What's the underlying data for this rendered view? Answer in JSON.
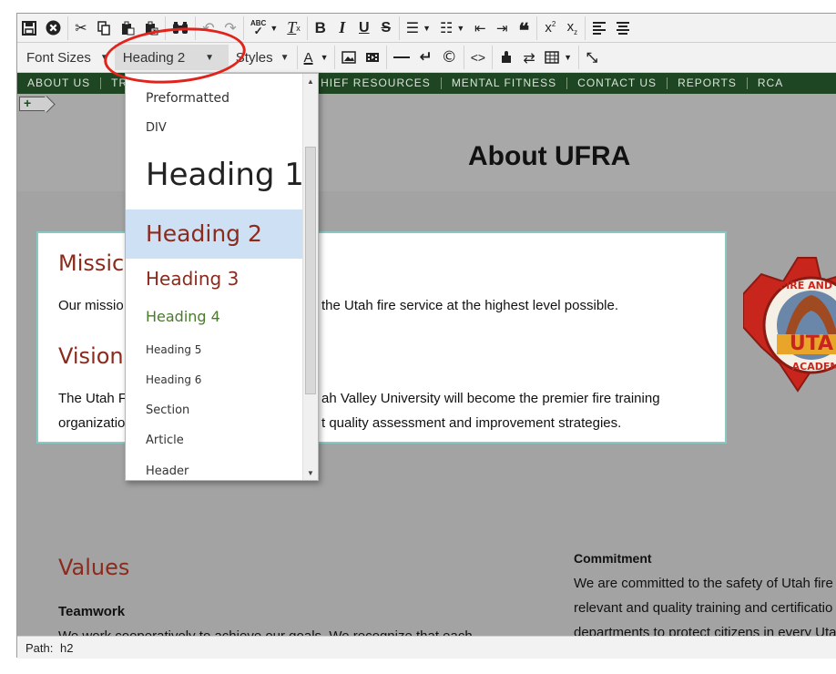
{
  "toolbar1": {
    "icons": [
      "save-icon",
      "cancel-icon",
      "cut-icon",
      "copy-icon",
      "paste-icon",
      "paste-text-icon",
      "find-icon",
      "undo-icon",
      "redo-icon",
      "spellcheck-icon",
      "clear-format-icon",
      "bold-icon",
      "italic-icon",
      "underline-icon",
      "strikethrough-icon",
      "bullet-list-icon",
      "numbered-list-icon",
      "outdent-icon",
      "indent-icon",
      "blockquote-icon",
      "superscript-icon",
      "subscript-icon",
      "align-left-icon",
      "align-center-icon"
    ]
  },
  "toolbar2": {
    "font_sizes_label": "Font Sizes",
    "block_format_value": "Heading 2",
    "styles_label": "Styles",
    "font_color_glyph": "A"
  },
  "nav": [
    "ABOUT US",
    "TR",
    "HIEF RESOURCES",
    "MENTAL FITNESS",
    "CONTACT US",
    "REPORTS",
    "RCA"
  ],
  "page": {
    "title": "About UFRA",
    "mission_heading": "Missic",
    "mission_text_left": "Our missio",
    "mission_text_right": "the Utah fire service at the highest level possible.",
    "vision_heading": "Vision",
    "vision_line1_left": "The Utah F",
    "vision_line1_right": "ah Valley University will become the premier fire training",
    "vision_line2_left": "organizatio",
    "vision_line2_right": "t quality assessment and improvement strategies.",
    "values_heading": "Values",
    "teamwork_heading": "Teamwork",
    "teamwork_text": "We work cooperatively to achieve our goals.  We recognize that each",
    "commitment_heading": "Commitment",
    "commitment_line1": "We are committed to the safety of Utah fire",
    "commitment_line2": "relevant and quality training and certificatio",
    "commitment_line3": "departments to protect citizens in every Uta"
  },
  "badge": {
    "text_top": "FIRE AND R",
    "text_mid": "UTA",
    "text_bottom": "ACADEM",
    "colors": {
      "red": "#c8261c",
      "gold": "#e8a52a",
      "brown": "#7a3b1e"
    }
  },
  "dropdown": {
    "items": [
      {
        "label": "Preformatted",
        "style": "pre"
      },
      {
        "label": "DIV",
        "style": "div"
      },
      {
        "label": "Heading 1",
        "style": "h1"
      },
      {
        "label": "Heading 2",
        "style": "h2",
        "selected": true
      },
      {
        "label": "Heading 3",
        "style": "h3"
      },
      {
        "label": "Heading 4",
        "style": "h4"
      },
      {
        "label": "Heading 5",
        "style": "h5"
      },
      {
        "label": "Heading 6",
        "style": "h6"
      },
      {
        "label": "Section",
        "style": "section"
      },
      {
        "label": "Article",
        "style": "article"
      },
      {
        "label": "Header",
        "style": "header"
      }
    ]
  },
  "status": {
    "path_label": "Path:",
    "path_value": "h2"
  },
  "colors": {
    "nav_bg": "#1f4623",
    "heading_red": "#8b2b1d",
    "heading4_green": "#4a7a2e",
    "selection_blue": "#cde0f4",
    "annotation_red": "#e0241c",
    "card_border": "#88c9c4"
  }
}
